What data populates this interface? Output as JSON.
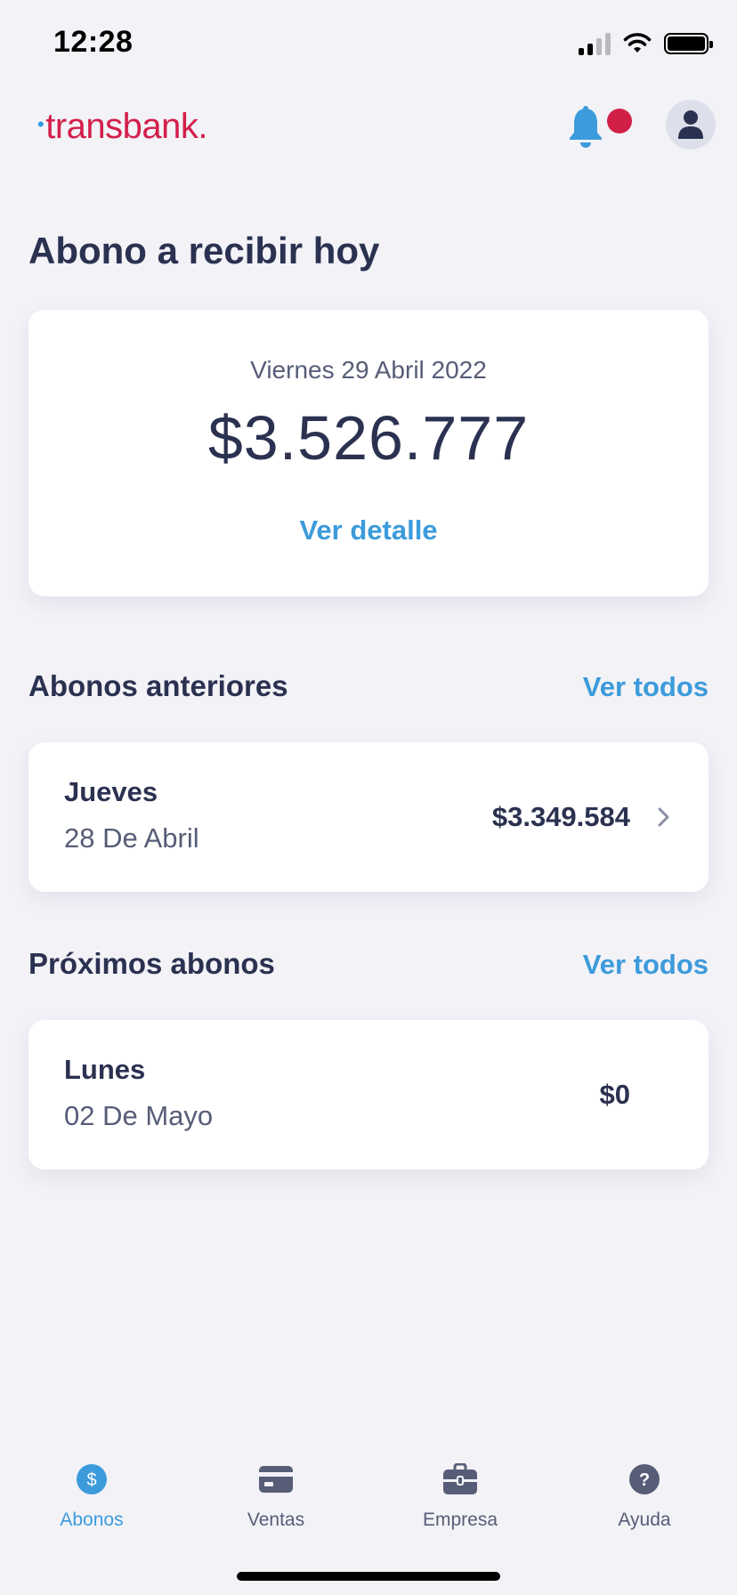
{
  "status_bar": {
    "time": "12:28"
  },
  "header": {
    "logo_text": "transbank.",
    "notification_icon": "bell-icon",
    "profile_icon": "user-icon",
    "colors": {
      "brand": "#d31f4a",
      "accent": "#3c9bdb",
      "notif": "#d21f48"
    }
  },
  "today": {
    "title": "Abono a recibir hoy",
    "date": "Viernes 29 Abril 2022",
    "amount": "$3.526.777",
    "detail_link": "Ver detalle"
  },
  "previous": {
    "title": "Abonos anteriores",
    "see_all": "Ver todos",
    "item": {
      "day": "Jueves",
      "date": "28 De Abril",
      "amount": "$3.349.584"
    }
  },
  "upcoming": {
    "title": "Próximos abonos",
    "see_all": "Ver todos",
    "item": {
      "day": "Lunes",
      "date": "02 De Mayo",
      "amount": "$0"
    }
  },
  "tabs": [
    {
      "label": "Abonos",
      "icon": "dollar-icon",
      "active": true
    },
    {
      "label": "Ventas",
      "icon": "card-icon",
      "active": false
    },
    {
      "label": "Empresa",
      "icon": "briefcase-icon",
      "active": false
    },
    {
      "label": "Ayuda",
      "icon": "help-icon",
      "active": false
    }
  ]
}
